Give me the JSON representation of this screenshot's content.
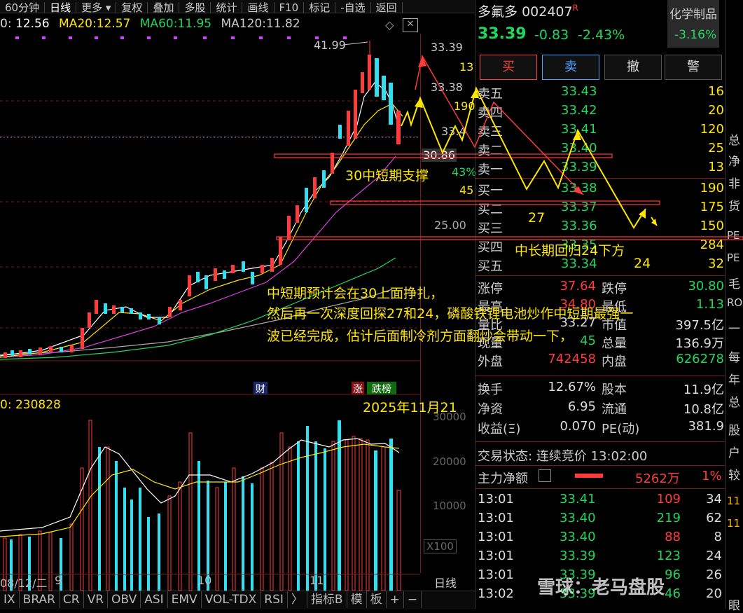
{
  "toolbar": {
    "items": [
      "60分钟",
      "日线",
      "更多 ▾",
      "复权",
      "叠加",
      "多股",
      "统计",
      "画线",
      "F10",
      "标记",
      "-自选",
      "返回"
    ]
  },
  "ma_line": {
    "prefix": "0:",
    "ma5": "12.56",
    "ma20_label": "MA20:",
    "ma20": "12.57",
    "ma60_label": "MA60:",
    "ma60": "11.95",
    "ma120_label": "MA120:",
    "ma120": "11.82"
  },
  "price_axis": {
    "high_label": "41.99",
    "top": "33.39",
    "v13": "13",
    "v3338": "33.38",
    "v190": "190",
    "v3341": "33.4",
    "cur": "30.86",
    "pct": "43%",
    "v45": "45",
    "p25": "25.00"
  },
  "vol": {
    "label": "0: 230828",
    "axis": [
      "30000",
      "20000",
      "10000"
    ],
    "unit": "X100"
  },
  "xaxis": {
    "d1": "08/12/二",
    "d2": "9",
    "d3": "10",
    "d4": "11",
    "tab": "日线"
  },
  "markers": {
    "cai": "财",
    "zhang": "涨",
    "dieb": "跌榜"
  },
  "bottom_tabs": [
    "IX",
    "BRAR",
    "CR",
    "VR",
    "OBV",
    "ASI",
    "EMV",
    "VOL-TDX",
    "RSI",
    "〉",
    "指标B",
    "模",
    "板",
    "+",
    "−"
  ],
  "stock": {
    "name": "多氟多",
    "code": "002407",
    "flag": "R",
    "price": "33.39",
    "change": "-0.83",
    "pct": "-2.43%",
    "sector": "化学制品",
    "sector_pct": "-3.16%"
  },
  "buttons": {
    "buy": "买",
    "sell": "卖",
    "cancel": "撤",
    "alert": "警"
  },
  "asks": [
    {
      "label": "卖五",
      "price": "33.43",
      "qty": "16"
    },
    {
      "label": "卖四",
      "price": "33.42",
      "qty": "20"
    },
    {
      "label": "卖三",
      "price": "33.41",
      "qty": "120"
    },
    {
      "label": "卖二",
      "price": "33.40",
      "qty": "25"
    },
    {
      "label": "卖一",
      "price": "33.39",
      "qty": "13"
    }
  ],
  "bids": [
    {
      "label": "买一",
      "price": "33.38",
      "qty": "190"
    },
    {
      "label": "买二",
      "price": "33.37",
      "qty": "175"
    },
    {
      "label": "买三",
      "price": "33.36",
      "qty": "150"
    },
    {
      "label": "买四",
      "price": "33.35",
      "qty": "284"
    },
    {
      "label": "买五",
      "price": "33.34",
      "qty": "32"
    }
  ],
  "stats": [
    {
      "l1": "涨停",
      "v1": "37.64",
      "l2": "跌停",
      "v2": "30.80"
    },
    {
      "l1": "最高",
      "v1": "34.80",
      "l2": "最低",
      "v2": "1.13"
    },
    {
      "l1": "量比",
      "v1": "33.27",
      "l2": "市值",
      "v2": "397.5亿"
    },
    {
      "l1": "现量",
      "v1": "45",
      "l2": "总量",
      "v2": "136.9万"
    },
    {
      "l1": "外盘",
      "v1": "742458",
      "l2": "内盘",
      "v2": "626278"
    },
    {
      "l1": "换手",
      "v1": "12.67%",
      "l2": "股本",
      "v2": "11.9亿"
    },
    {
      "l1": "净资",
      "v1": "6.95",
      "l2": "流通",
      "v2": "10.8亿"
    },
    {
      "l1": "收益(Ξ)",
      "v1": "0.070",
      "l2": "PE(动)",
      "v2": "381.9"
    }
  ],
  "status": {
    "label": "交易状态:",
    "value": "连续竞价",
    "time": "13:02:00"
  },
  "flow": {
    "label": "主力净额",
    "value": "5262万",
    "pct": "1%"
  },
  "ticks": [
    {
      "t": "13:01",
      "p": "33.41",
      "v": "109",
      "n": "34"
    },
    {
      "t": "13:01",
      "p": "33.40",
      "v": "219",
      "n": "62"
    },
    {
      "t": "13:01",
      "p": "33.40",
      "v": "88",
      "n": "8"
    },
    {
      "t": "13:01",
      "p": "33.39",
      "v": "123",
      "n": "24"
    },
    {
      "t": "13:01",
      "p": "33.39",
      "v": "96",
      "n": "26"
    },
    {
      "t": "13:02",
      "p": "33.39",
      "v": "46",
      "n": "20"
    }
  ],
  "side_strip": [
    "总",
    "净",
    "非",
    "货",
    "PE",
    "PE",
    "毛",
    "RO",
    "一",
    "每",
    "年",
    "总",
    "股",
    "户",
    "较",
    "11",
    "11",
    "眼"
  ],
  "annotations": {
    "support": "30中短期支撑",
    "n27": "27",
    "long": "中长期回归24下方",
    "n24": "24",
    "para1": "中短期预计会在30上面挣扎，",
    "para2": "然后再一次深度回探27和24，磷酸铁锂电池炒作中短期最强一",
    "para3": "波已经完成，估计后面制冷剂方面翻炒会带动一下，",
    "date": "2025年11月21"
  },
  "watermark": "雪球：老马盘股",
  "colors": {
    "up": "#ff3b3b",
    "down": "#22d65c",
    "annot": "#ffe600",
    "candle_up": "#ff3b3b",
    "candle_down": "#30e0f0"
  }
}
